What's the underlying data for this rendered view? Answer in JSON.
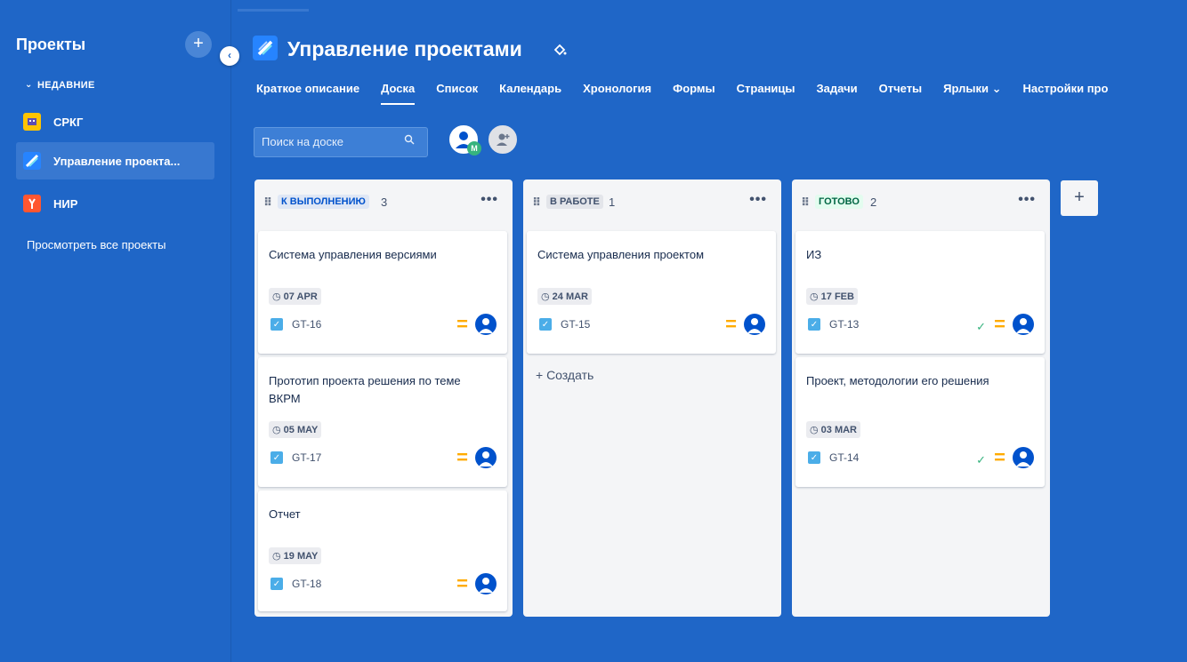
{
  "sidebar": {
    "title": "Проекты",
    "add_label": "+",
    "recent_label": "НЕДАВНИЕ",
    "projects": [
      {
        "name": "СРКГ"
      },
      {
        "name": "Управление проекта..."
      },
      {
        "name": "НИР"
      }
    ],
    "view_all": "Просмотреть все проекты"
  },
  "project": {
    "title": "Управление проектами"
  },
  "tabs": [
    {
      "label": "Краткое описание"
    },
    {
      "label": "Доска"
    },
    {
      "label": "Список"
    },
    {
      "label": "Календарь"
    },
    {
      "label": "Хронология"
    },
    {
      "label": "Формы"
    },
    {
      "label": "Страницы"
    },
    {
      "label": "Задачи"
    },
    {
      "label": "Отчеты"
    },
    {
      "label": "Ярлыки ⌄"
    },
    {
      "label": "Настройки про"
    }
  ],
  "search": {
    "placeholder": "Поиск на доске"
  },
  "avatar_badge": "M",
  "columns": [
    {
      "status": "К ВЫПОЛНЕНИЮ",
      "count": "3",
      "more": "•••",
      "status_color": "#0052cc",
      "status_bg": "#dfe7f5",
      "cards": [
        {
          "title": "Система управления версиями",
          "due": "07 APR",
          "key": "GT-16"
        },
        {
          "title": "Прототип проекта решения по теме ВКРМ",
          "due": "05 MAY",
          "key": "GT-17"
        },
        {
          "title": "Отчет",
          "due": "19 MAY",
          "key": "GT-18"
        }
      ]
    },
    {
      "status": "В РАБОТЕ",
      "count": "1",
      "more": "•••",
      "status_color": "#42526e",
      "status_bg": "#e3e5ea",
      "cards": [
        {
          "title": "Система управления проектом",
          "due": "24 MAR",
          "key": "GT-15"
        }
      ],
      "create_label": "+ Создать"
    },
    {
      "status": "ГОТОВО",
      "count": "2",
      "more": "•••",
      "status_color": "#006644",
      "status_bg": "#e3fcef",
      "cards": [
        {
          "title": "ИЗ",
          "due": "17 FEB",
          "key": "GT-13"
        },
        {
          "title": "Проект, методологии его решения",
          "due": "03 MAR",
          "key": "GT-14"
        }
      ]
    }
  ],
  "add_column_label": "+",
  "colors": {
    "background": "#1f66c7",
    "priority_medium": "#ffab00",
    "issue_type": "#4bade8",
    "done": "#36b37e"
  }
}
